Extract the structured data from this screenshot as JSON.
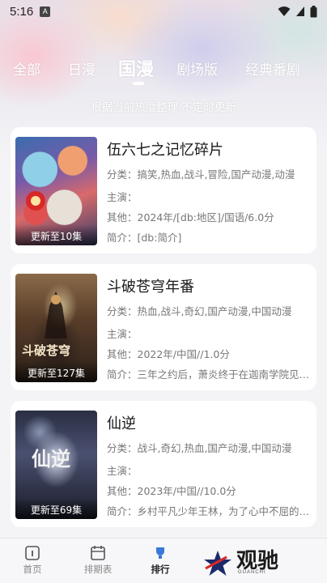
{
  "status_bar": {
    "time": "5:16",
    "notification_badge": "A"
  },
  "tabs": [
    {
      "label": "全部",
      "active": false
    },
    {
      "label": "日漫",
      "active": false
    },
    {
      "label": "国漫",
      "active": true
    },
    {
      "label": "剧场版",
      "active": false
    },
    {
      "label": "经典番剧",
      "active": false
    }
  ],
  "subtitle": "根据当前热度整理 不定时更新",
  "cards": [
    {
      "title": "伍六七之记忆碎片",
      "episode": "更新至10集",
      "genre": "分类：搞笑,热血,战斗,冒险,国产动漫,动漫",
      "cast": "主演：",
      "other": "其他：2024年/[db:地区]/国语/6.0分",
      "intro": "简介：[db:简介]"
    },
    {
      "title": "斗破苍穹年番",
      "episode": "更新至127集",
      "poster_text": "斗破苍穹",
      "genre": "分类：热血,战斗,奇幻,国产动漫,中国动漫",
      "cast": "主演：",
      "other": "其他：2022年/中国//1.0分",
      "intro": "简介：三年之约后，萧炎终于在迦南学院见到了"
    },
    {
      "title": "仙逆",
      "episode": "更新至69集",
      "poster_text": "仙逆",
      "genre": "分类：战斗,奇幻,热血,国产动漫,中国动漫",
      "cast": "主演：",
      "other": "其他：2023年/中国//10.0分",
      "intro": "简介：乡村平凡少年王林，为了心中不屈的执念"
    }
  ],
  "bottom_nav": [
    {
      "label": "首页",
      "icon": "home-icon"
    },
    {
      "label": "排期表",
      "icon": "calendar-icon"
    },
    {
      "label": "排行",
      "icon": "ranking-icon",
      "active": true
    }
  ],
  "watermark": {
    "name": "观驰",
    "sub": "GUANCHI"
  },
  "colors": {
    "accent": "#ffffff",
    "card_bg": "#ffffff",
    "text_muted": "#777777"
  }
}
